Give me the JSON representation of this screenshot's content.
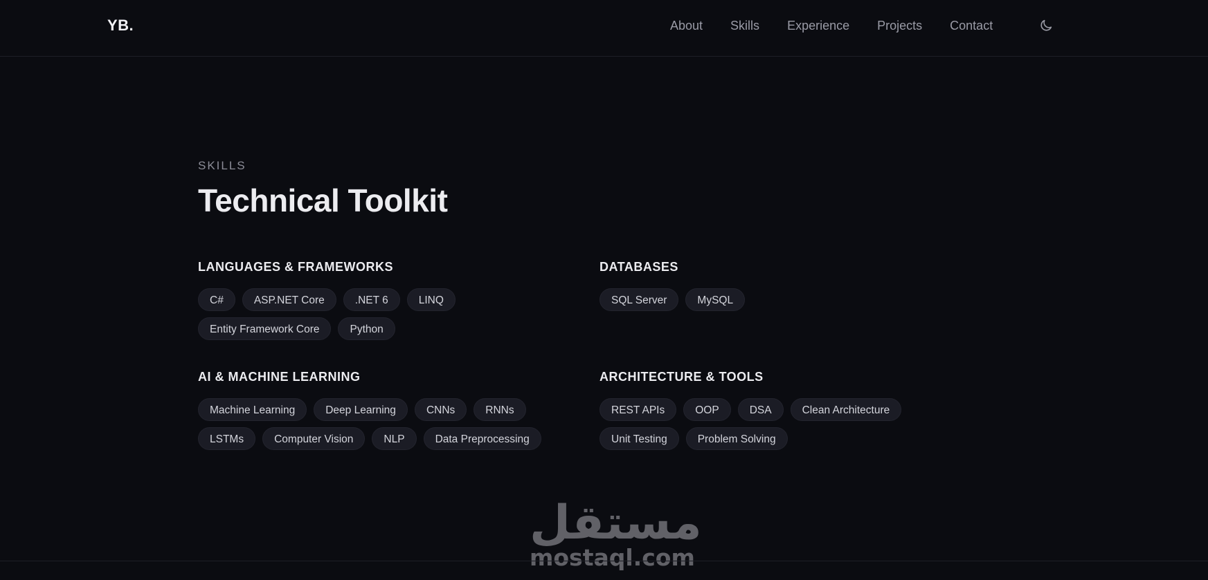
{
  "header": {
    "logo": "YB.",
    "nav": [
      {
        "label": "About",
        "id": "about"
      },
      {
        "label": "Skills",
        "id": "skills"
      },
      {
        "label": "Experience",
        "id": "experience"
      },
      {
        "label": "Projects",
        "id": "projects"
      },
      {
        "label": "Contact",
        "id": "contact"
      }
    ],
    "theme_toggle_icon": "moon-icon"
  },
  "skills": {
    "eyebrow": "SKILLS",
    "title": "Technical Toolkit",
    "groups": [
      {
        "title": "LANGUAGES & FRAMEWORKS",
        "items": [
          "C#",
          "ASP.NET Core",
          ".NET 6",
          "LINQ",
          "Entity Framework Core",
          "Python"
        ]
      },
      {
        "title": "DATABASES",
        "items": [
          "SQL Server",
          "MySQL"
        ]
      },
      {
        "title": "AI & MACHINE LEARNING",
        "items": [
          "Machine Learning",
          "Deep Learning",
          "CNNs",
          "RNNs",
          "LSTMs",
          "Computer Vision",
          "NLP",
          "Data Preprocessing"
        ]
      },
      {
        "title": "ARCHITECTURE & TOOLS",
        "items": [
          "REST APIs",
          "OOP",
          "DSA",
          "Clean Architecture",
          "Unit Testing",
          "Problem Solving"
        ]
      }
    ]
  },
  "watermark": {
    "arabic": "مستقل",
    "latin": "mostaql.com"
  },
  "colors": {
    "background": "#0b0c11",
    "chip_background": "#1b1c25",
    "text_primary": "#ececf0",
    "text_muted": "#9a9ba6"
  }
}
